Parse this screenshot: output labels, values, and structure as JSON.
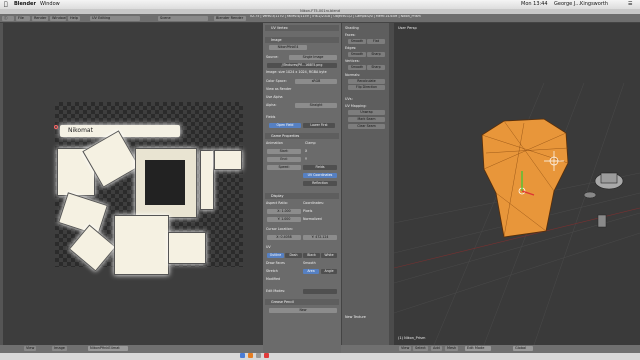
{
  "menubar": {
    "app": "Blender",
    "window": "Window",
    "clock": "Mon 13:44",
    "user": "George J...Kingsworth"
  },
  "title": "Nikon-F75-001rx.blend",
  "header": {
    "editor": "UV Editing",
    "scene": "Scene",
    "engine": "Blender Render",
    "stats": "v2.75 | Verts:3/1170 | Faces:4/1159 | Tris:2/2318 | Objects:1/2 | Lamps:0/0 | Mem:14.65M | Nikon_Prism"
  },
  "uv": {
    "logo_text": "Nikomat"
  },
  "uv_footer": {
    "view": "View",
    "image": "Image",
    "name": "NikonPfinkE4mat"
  },
  "props": {
    "uv_vertex": "UV Vertex",
    "image_title": "Image",
    "image_name": "NikonPfinkE4",
    "source_label": "Source:",
    "source_value": "Single Image",
    "file_path": "//Textures/Pfl...168E5.png",
    "image_info": "Image: size 1024 x 1024, RGBA byte",
    "color_space_label": "Color Space:",
    "color_space_value": "sRGB",
    "view_as_render": "View as Render",
    "use_alpha": "Use Alpha",
    "alpha_label": "Alpha:",
    "alpha_value": "Straight",
    "fields_label": "Fields",
    "fields_btn1": "Open Field",
    "fields_btn2": "Lower First",
    "game_props": "Game Properties",
    "animation": "Animation",
    "clamp": "Clamp",
    "start": "Start:",
    "end": "End:",
    "x": "X",
    "y": "Y",
    "fields": "Fields",
    "speed": "Speed:",
    "uv_coordinates": "UV Coordinates",
    "reflection": "Reflection",
    "display": "Display",
    "aspect_ratio": "Aspect Ratio:",
    "coordinates": "Coordinates:",
    "ax": "X: 1.000",
    "ay": "Y: 1.000",
    "pixels": "Pixels",
    "normalized": "Normalized",
    "cursor_location": "Cursor Location:",
    "cursor_x": "X: 0.4058",
    "cursor_y": "Y: 472.124",
    "uv_title": "UV",
    "tabs": [
      "Outline",
      "Dash",
      "Black",
      "White"
    ],
    "draw_faces": "Draw Faces",
    "smooth": "Smooth",
    "stretch": "Stretch",
    "modified": "Modified",
    "area": "Area",
    "angle": "Angle",
    "edit_modes": "Edit Modes:",
    "grease_pencil": "Grease Pencil",
    "new_btn": "New"
  },
  "tools": {
    "shading": "Shading",
    "faces": "Faces:",
    "smooth": "Smooth",
    "flat": "Flat",
    "edges": "Edges:",
    "sharp": "Sharp",
    "vertices": "Vertices:",
    "normals": "Normals:",
    "recalculate": "Recalculate",
    "flip_direction": "Flip Direction",
    "uvs": "UVs:",
    "uv_mapping": "UV Mapping:",
    "unwrap": "Unwrap",
    "mark_seam": "Mark Seam",
    "clear_seam": "Clear Seam",
    "new_texture": "New Texture",
    "side_tabs": [
      "Tools",
      "Create",
      "Relations",
      "Animation",
      "Physics",
      "Grease Pencil",
      "Shading / UVs"
    ]
  },
  "viewport": {
    "label": "User Persp",
    "object_label": "(1) Nikon_Prism"
  },
  "vp_footer": {
    "view": "View",
    "select": "Select",
    "add": "Add",
    "mesh": "Mesh",
    "mode": "Edit Mode",
    "global": "Global"
  },
  "colors": {
    "mesh": "#e8963a",
    "mesh_dark": "#8a4a10",
    "accent": "#5680c2"
  }
}
